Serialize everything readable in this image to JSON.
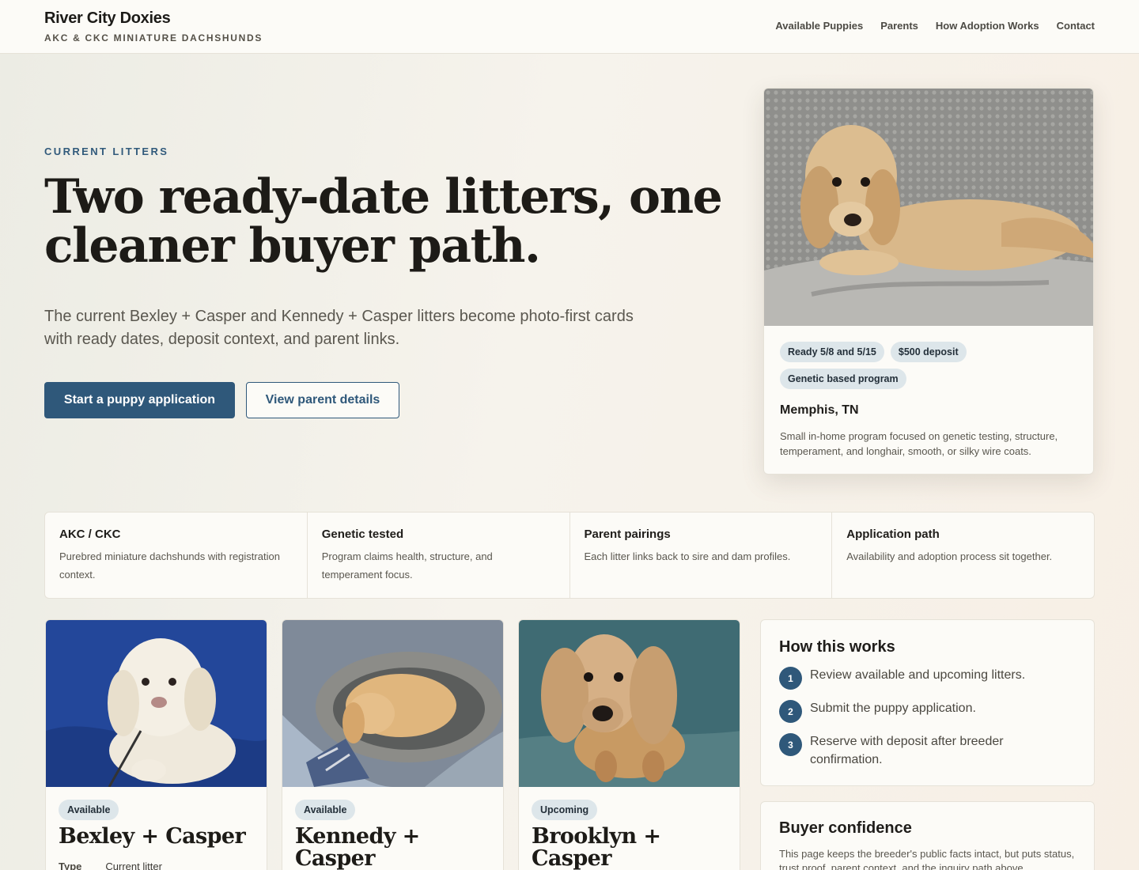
{
  "header": {
    "brand_name": "River City Doxies",
    "brand_tagline": "AKC & CKC MINIATURE DACHSHUNDS",
    "nav": [
      "Available Puppies",
      "Parents",
      "How Adoption Works",
      "Contact"
    ]
  },
  "hero": {
    "eyebrow": "CURRENT LITTERS",
    "headline": "Two ready-date litters, one cleaner buyer path.",
    "lede": "The current Bexley + Casper and Kennedy + Casper litters become photo-first cards with ready dates, deposit context, and parent links.",
    "primary_cta": "Start a puppy application",
    "secondary_cta": "View parent details"
  },
  "hero_card": {
    "chips": [
      "Ready 5/8 and 5/15",
      "$500 deposit",
      "Genetic based program"
    ],
    "location": "Memphis, TN",
    "description": "Small in-home program focused on genetic testing, structure, temperament, and longhair, smooth, or silky wire coats."
  },
  "features": [
    {
      "title": "AKC / CKC",
      "text": "Purebred miniature dachshunds with registration context."
    },
    {
      "title": "Genetic tested",
      "text": "Program claims health, structure, and temperament focus."
    },
    {
      "title": "Parent pairings",
      "text": "Each litter links back to sire and dam profiles."
    },
    {
      "title": "Application path",
      "text": "Availability and adoption process sit together."
    }
  ],
  "litters": [
    {
      "status": "Available",
      "name": "Bexley + Casper",
      "meta_key": "Type",
      "meta_value": "Current litter"
    },
    {
      "status": "Available",
      "name": "Kennedy + Casper"
    },
    {
      "status": "Upcoming",
      "name": "Brooklyn + Casper"
    }
  ],
  "how_it_works": {
    "title": "How this works",
    "steps": [
      {
        "num": "1",
        "text": "Review available and upcoming litters."
      },
      {
        "num": "2",
        "text": "Submit the puppy application."
      },
      {
        "num": "3",
        "text": "Reserve with deposit after breeder confirmation."
      }
    ]
  },
  "buyer_confidence": {
    "title": "Buyer confidence",
    "text": "This page keeps the breeder's public facts intact, but puts status, trust proof, parent context, and the inquiry path above"
  },
  "colors": {
    "accent": "#2f587a",
    "chip_bg": "#dde6ea",
    "card_bg": "#fcfbf7"
  },
  "icons": [
    "step-number-badge"
  ]
}
